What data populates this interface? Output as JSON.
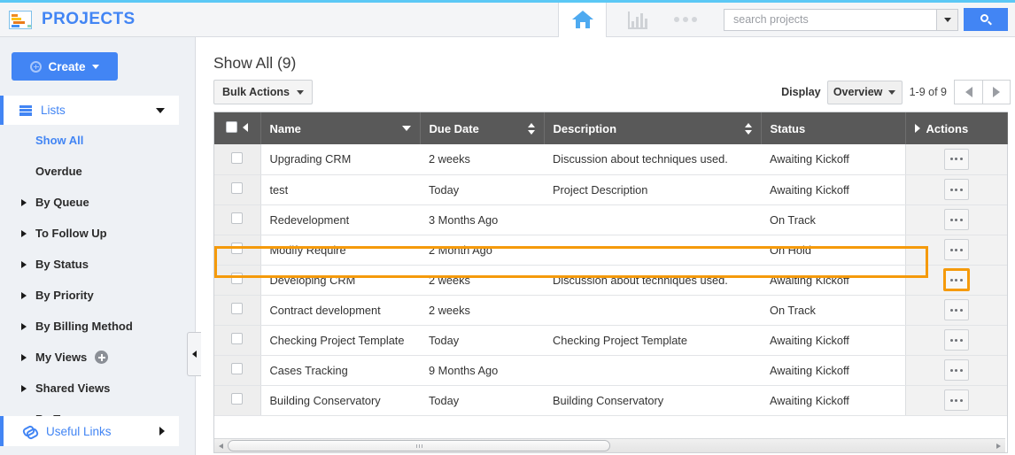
{
  "brand": {
    "title": "PROJECTS",
    "icon": "gantt-chart-icon"
  },
  "topbar": {
    "home_icon": "home-icon",
    "reports_icon": "bar-chart-icon",
    "more_icon": "ellipsis-icon",
    "search": {
      "value": "",
      "placeholder": "search projects",
      "dropdown_icon": "chevron-down-icon",
      "button_icon": "search-icon"
    }
  },
  "sidebar": {
    "create_label": "Create",
    "create_icon": "plus-circle-icon",
    "create_caret": "caret-down-icon",
    "section": {
      "label": "Lists",
      "icon": "grid-icon",
      "chevron": "chevron-down-icon"
    },
    "items": [
      {
        "label": "Show All",
        "active": true,
        "expandable": false
      },
      {
        "label": "Overdue",
        "active": false,
        "expandable": false
      },
      {
        "label": "By Queue",
        "active": false,
        "expandable": true
      },
      {
        "label": "To Follow Up",
        "active": false,
        "expandable": true
      },
      {
        "label": "By Status",
        "active": false,
        "expandable": true
      },
      {
        "label": "By Priority",
        "active": false,
        "expandable": true
      },
      {
        "label": "By Billing Method",
        "active": false,
        "expandable": true
      },
      {
        "label": "My Views",
        "active": false,
        "expandable": true,
        "badge": "plus-badge-icon"
      },
      {
        "label": "Shared Views",
        "active": false,
        "expandable": true
      },
      {
        "label": "By Tag",
        "active": false,
        "expandable": true
      }
    ],
    "useful_links": {
      "label": "Useful Links",
      "icon": "link-icon",
      "chevron": "chevron-right-icon"
    },
    "collapse_handle": "chevron-left-icon"
  },
  "main": {
    "title": "Show All (9)",
    "bulk_actions_label": "Bulk Actions",
    "display_label": "Display",
    "display_value": "Overview",
    "range_text": "1-9 of 9",
    "prev_icon": "chevron-left-icon",
    "next_icon": "chevron-right-icon"
  },
  "table": {
    "columns": [
      {
        "label": "Name",
        "sort": "desc"
      },
      {
        "label": "Due Date",
        "sort": "both"
      },
      {
        "label": "Description",
        "sort": "both"
      },
      {
        "label": "Status",
        "sort": "none"
      },
      {
        "label": "Actions",
        "sort": "none"
      }
    ],
    "rows": [
      {
        "name": "Upgrading CRM",
        "due": "2 weeks",
        "desc": "Discussion about techniques used.",
        "status": "Awaiting Kickoff",
        "highlighted": false
      },
      {
        "name": "test",
        "due": "Today",
        "desc": "Project Description",
        "status": "Awaiting Kickoff",
        "highlighted": false
      },
      {
        "name": "Redevelopment",
        "due": "3 Months Ago",
        "desc": "",
        "status": "On Track",
        "highlighted": false
      },
      {
        "name": "Modify Require",
        "due": "2 Month Ago",
        "desc": "",
        "status": "On Hold",
        "highlighted": false
      },
      {
        "name": "Developing CRM",
        "due": "2 weeks",
        "desc": "Discussion about techniques used.",
        "status": "Awaiting Kickoff",
        "highlighted": true
      },
      {
        "name": "Contract development",
        "due": "2 weeks",
        "desc": "",
        "status": "On Track",
        "highlighted": false
      },
      {
        "name": "Checking Project Template",
        "due": "Today",
        "desc": "Checking Project Template",
        "status": "Awaiting Kickoff",
        "highlighted": false
      },
      {
        "name": "Cases Tracking",
        "due": "9 Months Ago",
        "desc": "",
        "status": "Awaiting Kickoff",
        "highlighted": false
      },
      {
        "name": "Building Conservatory",
        "due": "Today",
        "desc": "Building Conservatory",
        "status": "Awaiting Kickoff",
        "highlighted": false
      }
    ],
    "row_action_icon": "ellipsis-icon"
  },
  "colors": {
    "brand_blue": "#4285f4",
    "accent_top": "#5bc8f5",
    "header_gray": "#595959",
    "highlight_orange": "#f59a0b",
    "sidebar_bg": "#eef1f5"
  }
}
